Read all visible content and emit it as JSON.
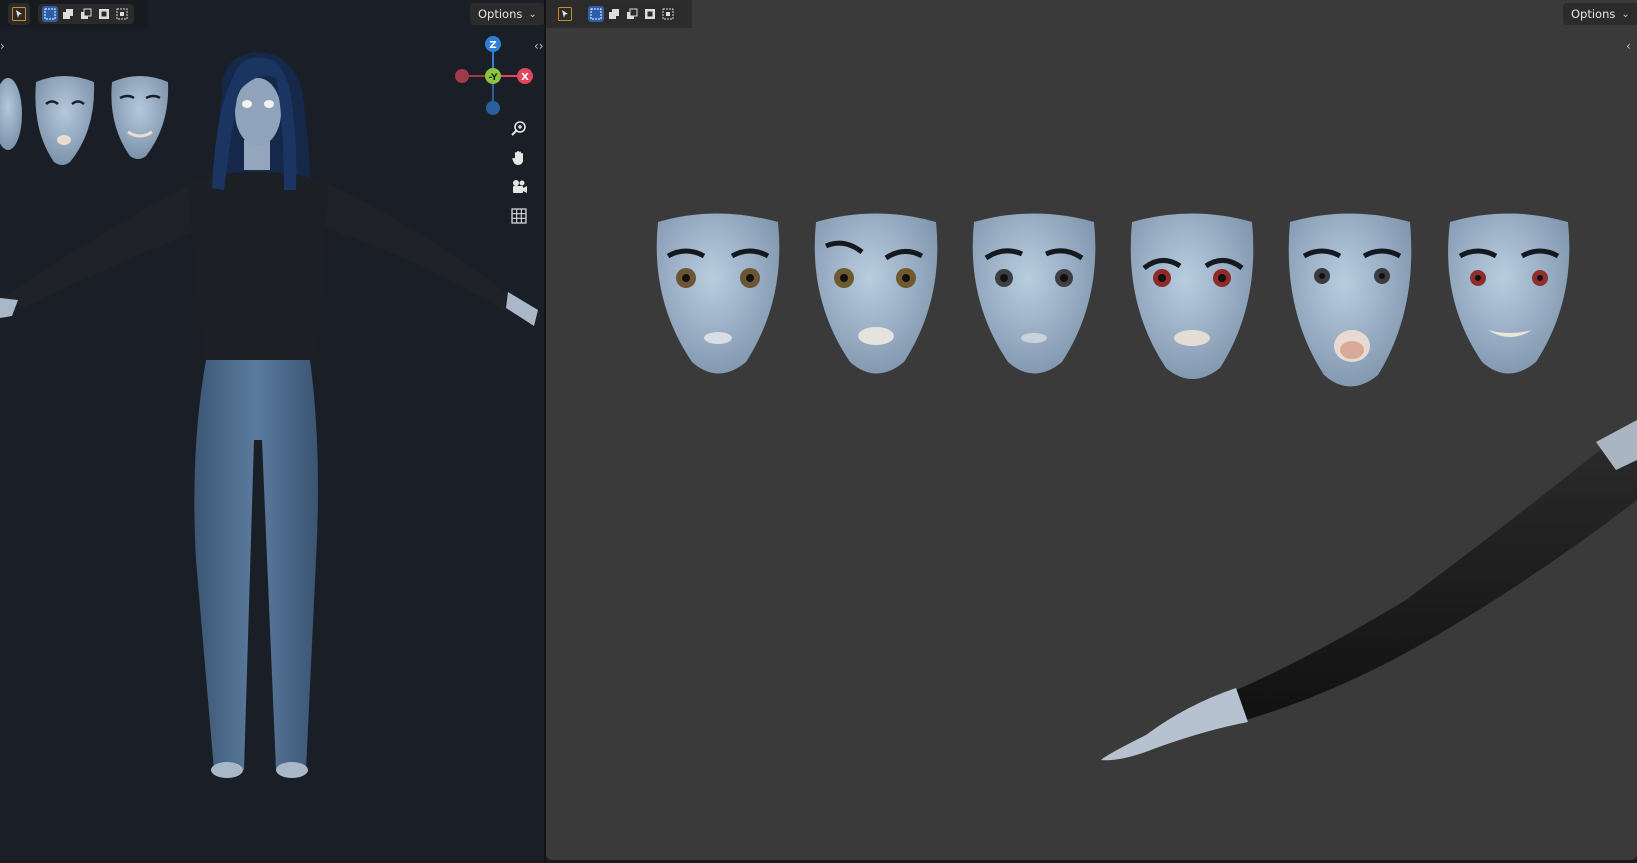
{
  "left_viewport": {
    "header": {
      "options_label": "Options"
    },
    "gizmo": {
      "z_label": "Z",
      "x_label": "X",
      "y_label": "-Y"
    }
  },
  "right_viewport": {
    "header": {
      "options_label": "Options"
    }
  },
  "colors": {
    "select_active": "#2d5ea8",
    "axis_z": "#2f7fd6",
    "axis_x": "#e0455a",
    "axis_y": "#8bc53f",
    "left_bg": "#1a1f27",
    "right_bg": "#3a3a3a"
  },
  "icons": [
    "cursor-icon",
    "select-new-icon",
    "select-extend-icon",
    "select-subtract-icon",
    "select-invert-icon",
    "select-intersect-icon",
    "zoom-icon",
    "pan-hand-icon",
    "camera-icon",
    "grid-icon"
  ]
}
